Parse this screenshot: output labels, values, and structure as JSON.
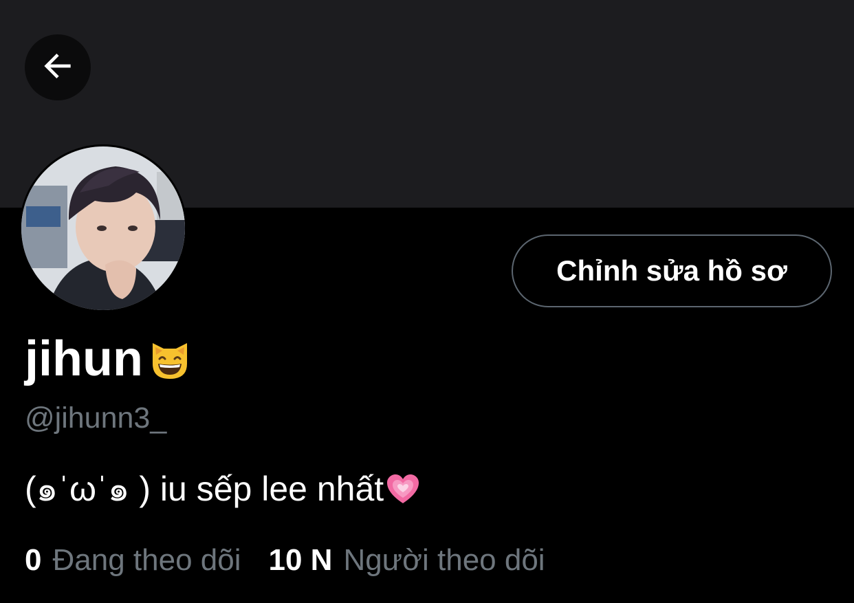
{
  "profile": {
    "display_name": "jihun",
    "display_emoji": "grinning-cat-emoji",
    "handle": "@jihunn3_",
    "bio_text": "(๑ˈωˈ๑ ) iu sếp lee nhất",
    "bio_emoji": "growing-heart-emoji"
  },
  "actions": {
    "back_icon": "arrow-left-icon",
    "edit_profile_label": "Chỉnh sửa hồ sơ"
  },
  "stats": {
    "following_count": "0",
    "following_label": "Đang theo dõi",
    "followers_count": "10 N",
    "followers_label": "Người theo dõi"
  },
  "colors": {
    "background": "#000000",
    "banner": "#1c1c1f",
    "primary_text": "#ffffff",
    "secondary_text": "#6e767d",
    "button_border": "#5c6670"
  }
}
